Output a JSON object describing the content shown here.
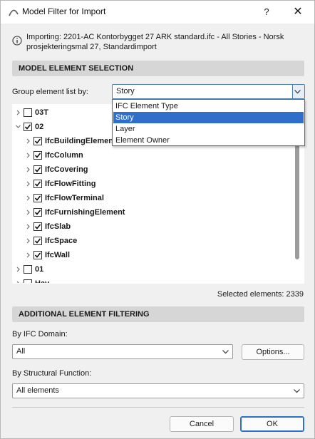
{
  "window": {
    "title": "Model Filter for Import",
    "help_label": "?",
    "close_label": "✕"
  },
  "info": {
    "text": "Importing: 2201-AC Kontorbygget 27 ARK standard.ifc - All Stories - Norsk prosjekteringsmal 27, Standardimport"
  },
  "model_selection": {
    "header": "MODEL ELEMENT SELECTION",
    "group_label": "Group element list by:",
    "group_value": "Story",
    "group_options": [
      "IFC Element Type",
      "Story",
      "Layer",
      "Element Owner"
    ],
    "group_selected_index": 1
  },
  "tree": {
    "items": [
      {
        "label": "03T",
        "level": 0,
        "expanded": false,
        "checked": false
      },
      {
        "label": "02",
        "level": 0,
        "expanded": true,
        "checked": true
      },
      {
        "label": "IfcBuildingElementProxy",
        "level": 1,
        "expanded": false,
        "checked": true
      },
      {
        "label": "IfcColumn",
        "level": 1,
        "expanded": false,
        "checked": true
      },
      {
        "label": "IfcCovering",
        "level": 1,
        "expanded": false,
        "checked": true
      },
      {
        "label": "IfcFlowFitting",
        "level": 1,
        "expanded": false,
        "checked": true
      },
      {
        "label": "IfcFlowTerminal",
        "level": 1,
        "expanded": false,
        "checked": true
      },
      {
        "label": "IfcFurnishingElement",
        "level": 1,
        "expanded": false,
        "checked": true
      },
      {
        "label": "IfcSlab",
        "level": 1,
        "expanded": false,
        "checked": true
      },
      {
        "label": "IfcSpace",
        "level": 1,
        "expanded": false,
        "checked": true
      },
      {
        "label": "IfcWall",
        "level": 1,
        "expanded": false,
        "checked": true
      },
      {
        "label": "01",
        "level": 0,
        "expanded": false,
        "checked": false
      },
      {
        "label": "Hav",
        "level": 0,
        "expanded": false,
        "checked": false
      }
    ],
    "selected_elements_text": "Selected elements: 2339"
  },
  "additional_filtering": {
    "header": "ADDITIONAL ELEMENT FILTERING",
    "domain_label": "By IFC Domain:",
    "domain_value": "All",
    "options_button": "Options...",
    "structural_label": "By Structural Function:",
    "structural_value": "All elements"
  },
  "footer": {
    "cancel_label": "Cancel",
    "ok_label": "OK"
  },
  "colors": {
    "accent": "#2f6fcb",
    "section_bg": "#d6d6d6",
    "dialog_bg": "#f0f0f0"
  },
  "icons": {
    "app": "archicad-arc-icon",
    "info": "info-icon",
    "chevron": "chevron-down-icon",
    "expand": "chevron-right-icon",
    "collapse": "chevron-down-icon",
    "check": "checkmark-icon"
  }
}
